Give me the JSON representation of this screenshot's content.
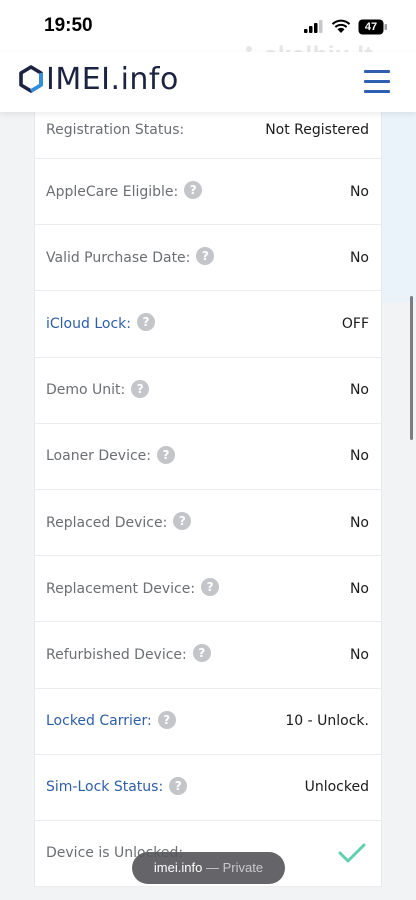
{
  "status_bar": {
    "time": "19:50",
    "battery": "47",
    "signal_icon": "cellular-signal-icon",
    "wifi_icon": "wifi-icon",
    "battery_icon": "battery-icon"
  },
  "watermark": "skelbiu.lt",
  "header": {
    "logo": "IMEI.info",
    "menu_icon": "hamburger-menu-icon"
  },
  "colors": {
    "brand_blue": "#2f5fb3",
    "link_blue": "#2d5ea8",
    "check_green": "#5fcfb0"
  },
  "rows": [
    {
      "label": "Registration Status:",
      "value": "Not Registered",
      "help": false,
      "link": false
    },
    {
      "label": "AppleCare Eligible:",
      "value": "No",
      "help": true,
      "link": false
    },
    {
      "label": "Valid Purchase Date:",
      "value": "No",
      "help": true,
      "link": false
    },
    {
      "label": "iCloud Lock:",
      "value": "OFF",
      "help": true,
      "link": true
    },
    {
      "label": "Demo Unit:",
      "value": "No",
      "help": true,
      "link": false
    },
    {
      "label": "Loaner Device:",
      "value": "No",
      "help": true,
      "link": false
    },
    {
      "label": "Replaced Device:",
      "value": "No",
      "help": true,
      "link": false
    },
    {
      "label": "Replacement Device:",
      "value": "No",
      "help": true,
      "link": false
    },
    {
      "label": "Refurbished Device:",
      "value": "No",
      "help": true,
      "link": false
    },
    {
      "label": "Locked Carrier:",
      "value": "10 - Unlock.",
      "help": true,
      "link": true
    },
    {
      "label": "Sim-Lock Status:",
      "value": "Unlocked",
      "help": true,
      "link": true
    },
    {
      "label": "Device is Unlocked:",
      "value": "",
      "help": false,
      "link": false,
      "check": true
    }
  ],
  "help_glyph": "?",
  "private_pill": {
    "site": "imei.info",
    "separator": "—",
    "mode": "Private"
  }
}
